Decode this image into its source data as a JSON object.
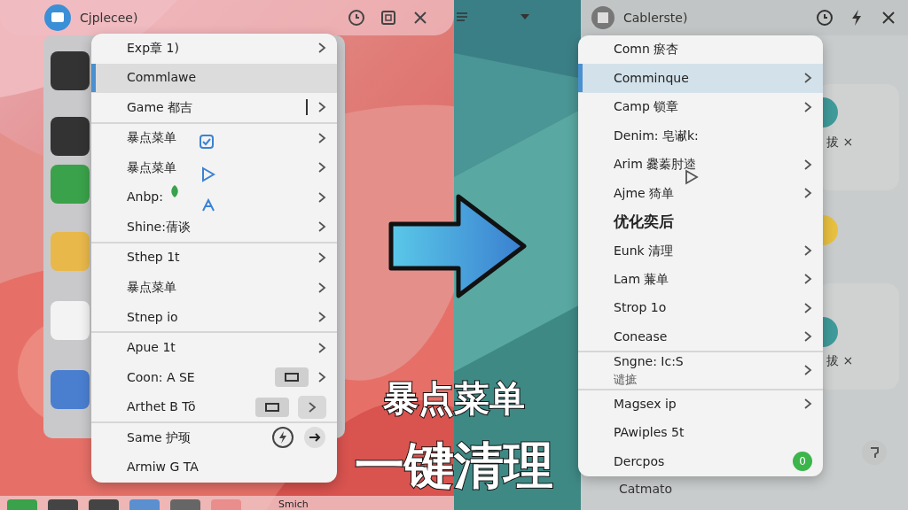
{
  "left_window": {
    "title": "Cjplecee)",
    "menu": [
      {
        "label": "Exp章 1)",
        "selected": false,
        "kind": "chevron",
        "divider_after": false
      },
      {
        "label": "Commlawe",
        "selected": true,
        "kind": "none",
        "divider_after": false
      },
      {
        "label": "Game 都吉",
        "selected": false,
        "kind": "bar-chevron",
        "divider_after": true
      },
      {
        "label": "暴点菜单",
        "selected": false,
        "kind": "chevron",
        "divider_after": false
      },
      {
        "label": "暴点菜单",
        "selected": false,
        "kind": "chevron",
        "divider_after": false
      },
      {
        "label": "Anbp:",
        "selected": false,
        "kind": "chevron",
        "divider_after": false
      },
      {
        "label": "Shine:蒨谈",
        "selected": false,
        "kind": "chevron",
        "divider_after": true
      },
      {
        "label": "Sthep 1t",
        "selected": false,
        "kind": "chevron",
        "divider_after": false
      },
      {
        "label": "暴点菜单",
        "selected": false,
        "kind": "chevron",
        "divider_after": false
      },
      {
        "label": "Stnep io",
        "selected": false,
        "kind": "chevron",
        "divider_after": true
      },
      {
        "label": "Apue 1t",
        "selected": false,
        "kind": "chevron",
        "divider_after": false
      },
      {
        "label": "Coon: A SE",
        "selected": false,
        "kind": "toggle-chevron",
        "divider_after": false
      },
      {
        "label": "Arthet B Tö",
        "selected": false,
        "kind": "toggle-chevron-button",
        "divider_after": true
      },
      {
        "label": "Same 护顼",
        "selected": false,
        "kind": "bolt-arrow",
        "divider_after": false
      },
      {
        "label": "Armiw G TA",
        "selected": false,
        "kind": "none",
        "divider_after": false
      }
    ],
    "dock_label": "Smich"
  },
  "right_window": {
    "title": "Cablerste)",
    "menu": [
      {
        "label": "Comn 瘀杏",
        "selected": false,
        "kind": "none",
        "divider_after": false
      },
      {
        "label": "Comminque",
        "selected": true,
        "kind": "chevron",
        "divider_after": false
      },
      {
        "label": "Camp 锁章",
        "selected": false,
        "kind": "chevron",
        "divider_after": false
      },
      {
        "label": "Denim: 皂谳k:",
        "selected": false,
        "kind": "none",
        "divider_after": false
      },
      {
        "label": "Arim 爨蓁肘逵",
        "selected": false,
        "kind": "chevron",
        "divider_after": false
      },
      {
        "label": "Ajme 猗单",
        "selected": false,
        "kind": "chevron",
        "divider_after": false
      },
      {
        "label": "优化奕后",
        "selected": false,
        "bold": true,
        "kind": "none",
        "divider_after": false
      },
      {
        "label": "Eunk 清理",
        "selected": false,
        "kind": "chevron",
        "divider_after": false
      },
      {
        "label": "Lam 蒹单",
        "selected": false,
        "kind": "chevron",
        "divider_after": false
      },
      {
        "label": "Strop 1o",
        "selected": false,
        "kind": "chevron",
        "divider_after": false
      },
      {
        "label": "Conease",
        "selected": false,
        "kind": "chevron",
        "divider_after": true
      },
      {
        "label": "Sngne: Ic:S",
        "sublabel": "谴摭",
        "selected": false,
        "kind": "chevron",
        "divider_after": true
      },
      {
        "label": "Magsex ip",
        "selected": false,
        "kind": "chevron",
        "divider_after": false
      },
      {
        "label": "PAwiples 5t",
        "selected": false,
        "kind": "none",
        "divider_after": false
      },
      {
        "label": "Dercpos",
        "selected": false,
        "kind": "badge",
        "badge": "0",
        "divider_after": false
      }
    ],
    "side_cards": [
      {
        "label": "拔 ×"
      },
      {
        "label": "拔 ×"
      }
    ],
    "footer_label": "Catmato"
  },
  "caption": [
    "暴点菜单",
    "一键清理"
  ]
}
